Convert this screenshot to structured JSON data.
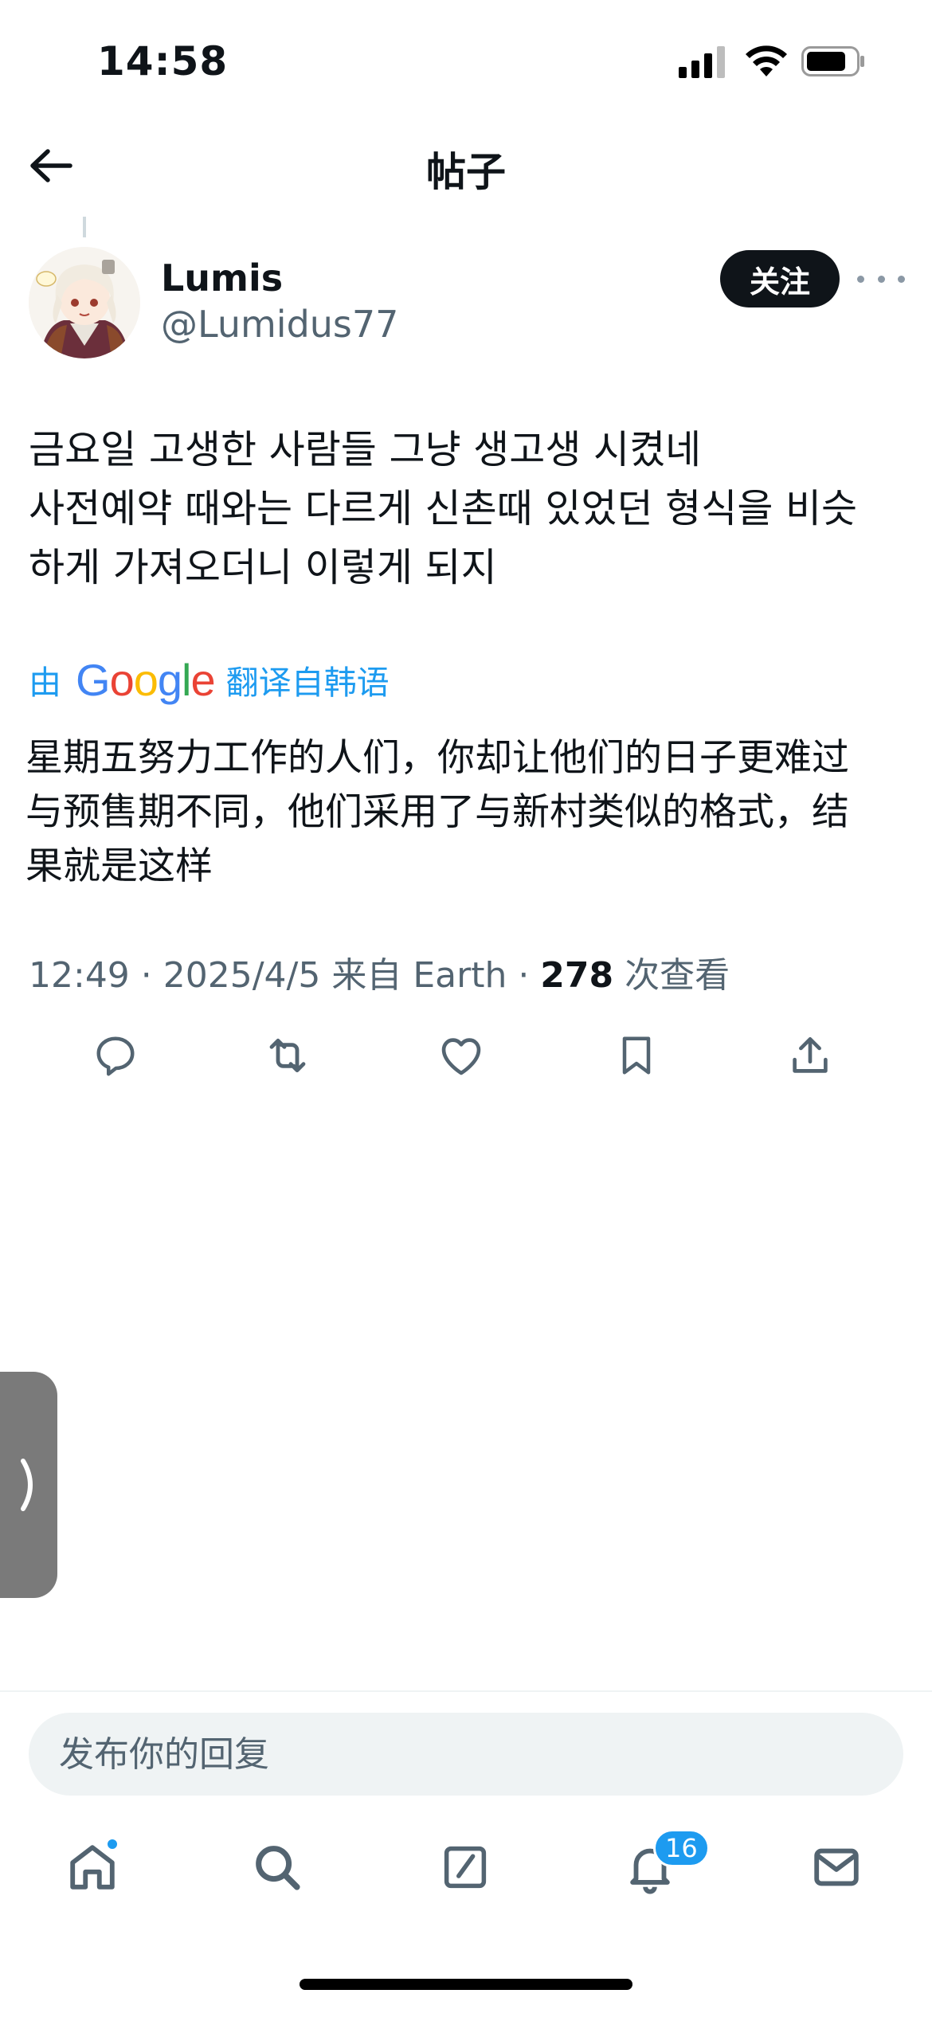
{
  "status_bar": {
    "time": "14:58",
    "battery_level": 0.8
  },
  "header": {
    "title": "帖子"
  },
  "post": {
    "author_name": "Lumis",
    "author_handle": "@Lumidus77",
    "follow_label": "关注",
    "text_lines": [
      "금요일 고생한 사람들 그냥 생고생 시켰네",
      "사전예약 때와는 다르게 신촌때 있었던 형식을 비슷",
      "하게 가져오더니 이렇게 되지"
    ],
    "translate": {
      "prefix": "由",
      "brand": "Google",
      "suffix": "翻译自韩语"
    },
    "translated_lines": [
      "星期五努力工作的人们，你却让他们的日子更难过",
      "与预售期不同，他们采用了与新村类似的格式，结",
      "果就是这样"
    ],
    "meta": {
      "time_date_source": "12:49 · 2025/4/5 来自 Earth · ",
      "views_count": "278",
      "views_label": " 次查看"
    },
    "actions": [
      "reply-icon",
      "retweet-icon",
      "like-icon",
      "bookmark-icon",
      "share-icon"
    ]
  },
  "reply": {
    "placeholder": "发布你的回复"
  },
  "tab_bar": {
    "items": [
      "home-icon",
      "search-icon",
      "compose-icon",
      "notifications-icon",
      "messages-icon"
    ],
    "notifications_badge": "16"
  },
  "colors": {
    "accent": "#1d9bf0",
    "text": "#0f1419",
    "secondary": "#536471",
    "google_blue": "#4285f4",
    "google_red": "#ea4335",
    "google_yellow": "#fbbc05",
    "google_green": "#34a853"
  }
}
